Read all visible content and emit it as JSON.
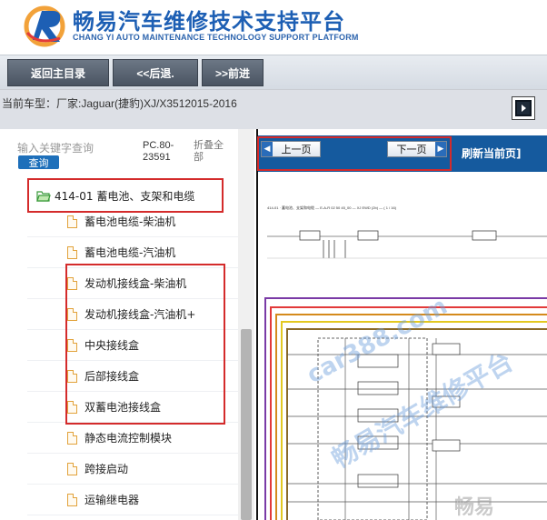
{
  "header": {
    "title": "畅易汽车维修技术支持平台",
    "subtitle": "CHANG YI AUTO MAINTENANCE TECHNOLOGY SUPPORT PLATFORM"
  },
  "toolbar": {
    "home_label": "返回主目录",
    "back_label": "<<后退.",
    "forward_label": ">>前进"
  },
  "vehicle": {
    "label": "当前车型：",
    "value": "厂家:Jaguar(捷豹)XJ/X3512015-2016"
  },
  "search": {
    "placeholder": "输入关键字查询",
    "button_label": "查询"
  },
  "tree": {
    "code": "PC.80-23591",
    "collapse_all": "折叠全部",
    "folder_label": "414-01 蓄电池、支架和电缆",
    "items": [
      {
        "label": "蓄电池电缆-柴油机"
      },
      {
        "label": "蓄电池电缆-汽油机"
      },
      {
        "label": "发动机接线盒-柴油机"
      },
      {
        "label": "发动机接线盒-汽油机+"
      },
      {
        "label": "中央接线盒"
      },
      {
        "label": "后部接线盒"
      },
      {
        "label": "双蓄电池接线盒"
      },
      {
        "label": "静态电流控制模块"
      },
      {
        "label": "跨接启动"
      },
      {
        "label": "运输继电器"
      }
    ]
  },
  "viewer": {
    "prev_label": "上一页",
    "next_label": "下一页",
    "refresh_label": "刷新当前页]",
    "caption": "414-01 · 蓄电池、支架和电缆 — E-A-R 02 50 45_00 — XJ EWD (2b) — ( 1 / 16)",
    "watermark_1": "car388.com",
    "watermark_2": "畅易汽车维修平台",
    "watermark_3": "畅易"
  },
  "colors": {
    "brand_blue": "#1d5fb4",
    "nav_blue": "#155a9e",
    "highlight_red": "#d42b2b"
  }
}
